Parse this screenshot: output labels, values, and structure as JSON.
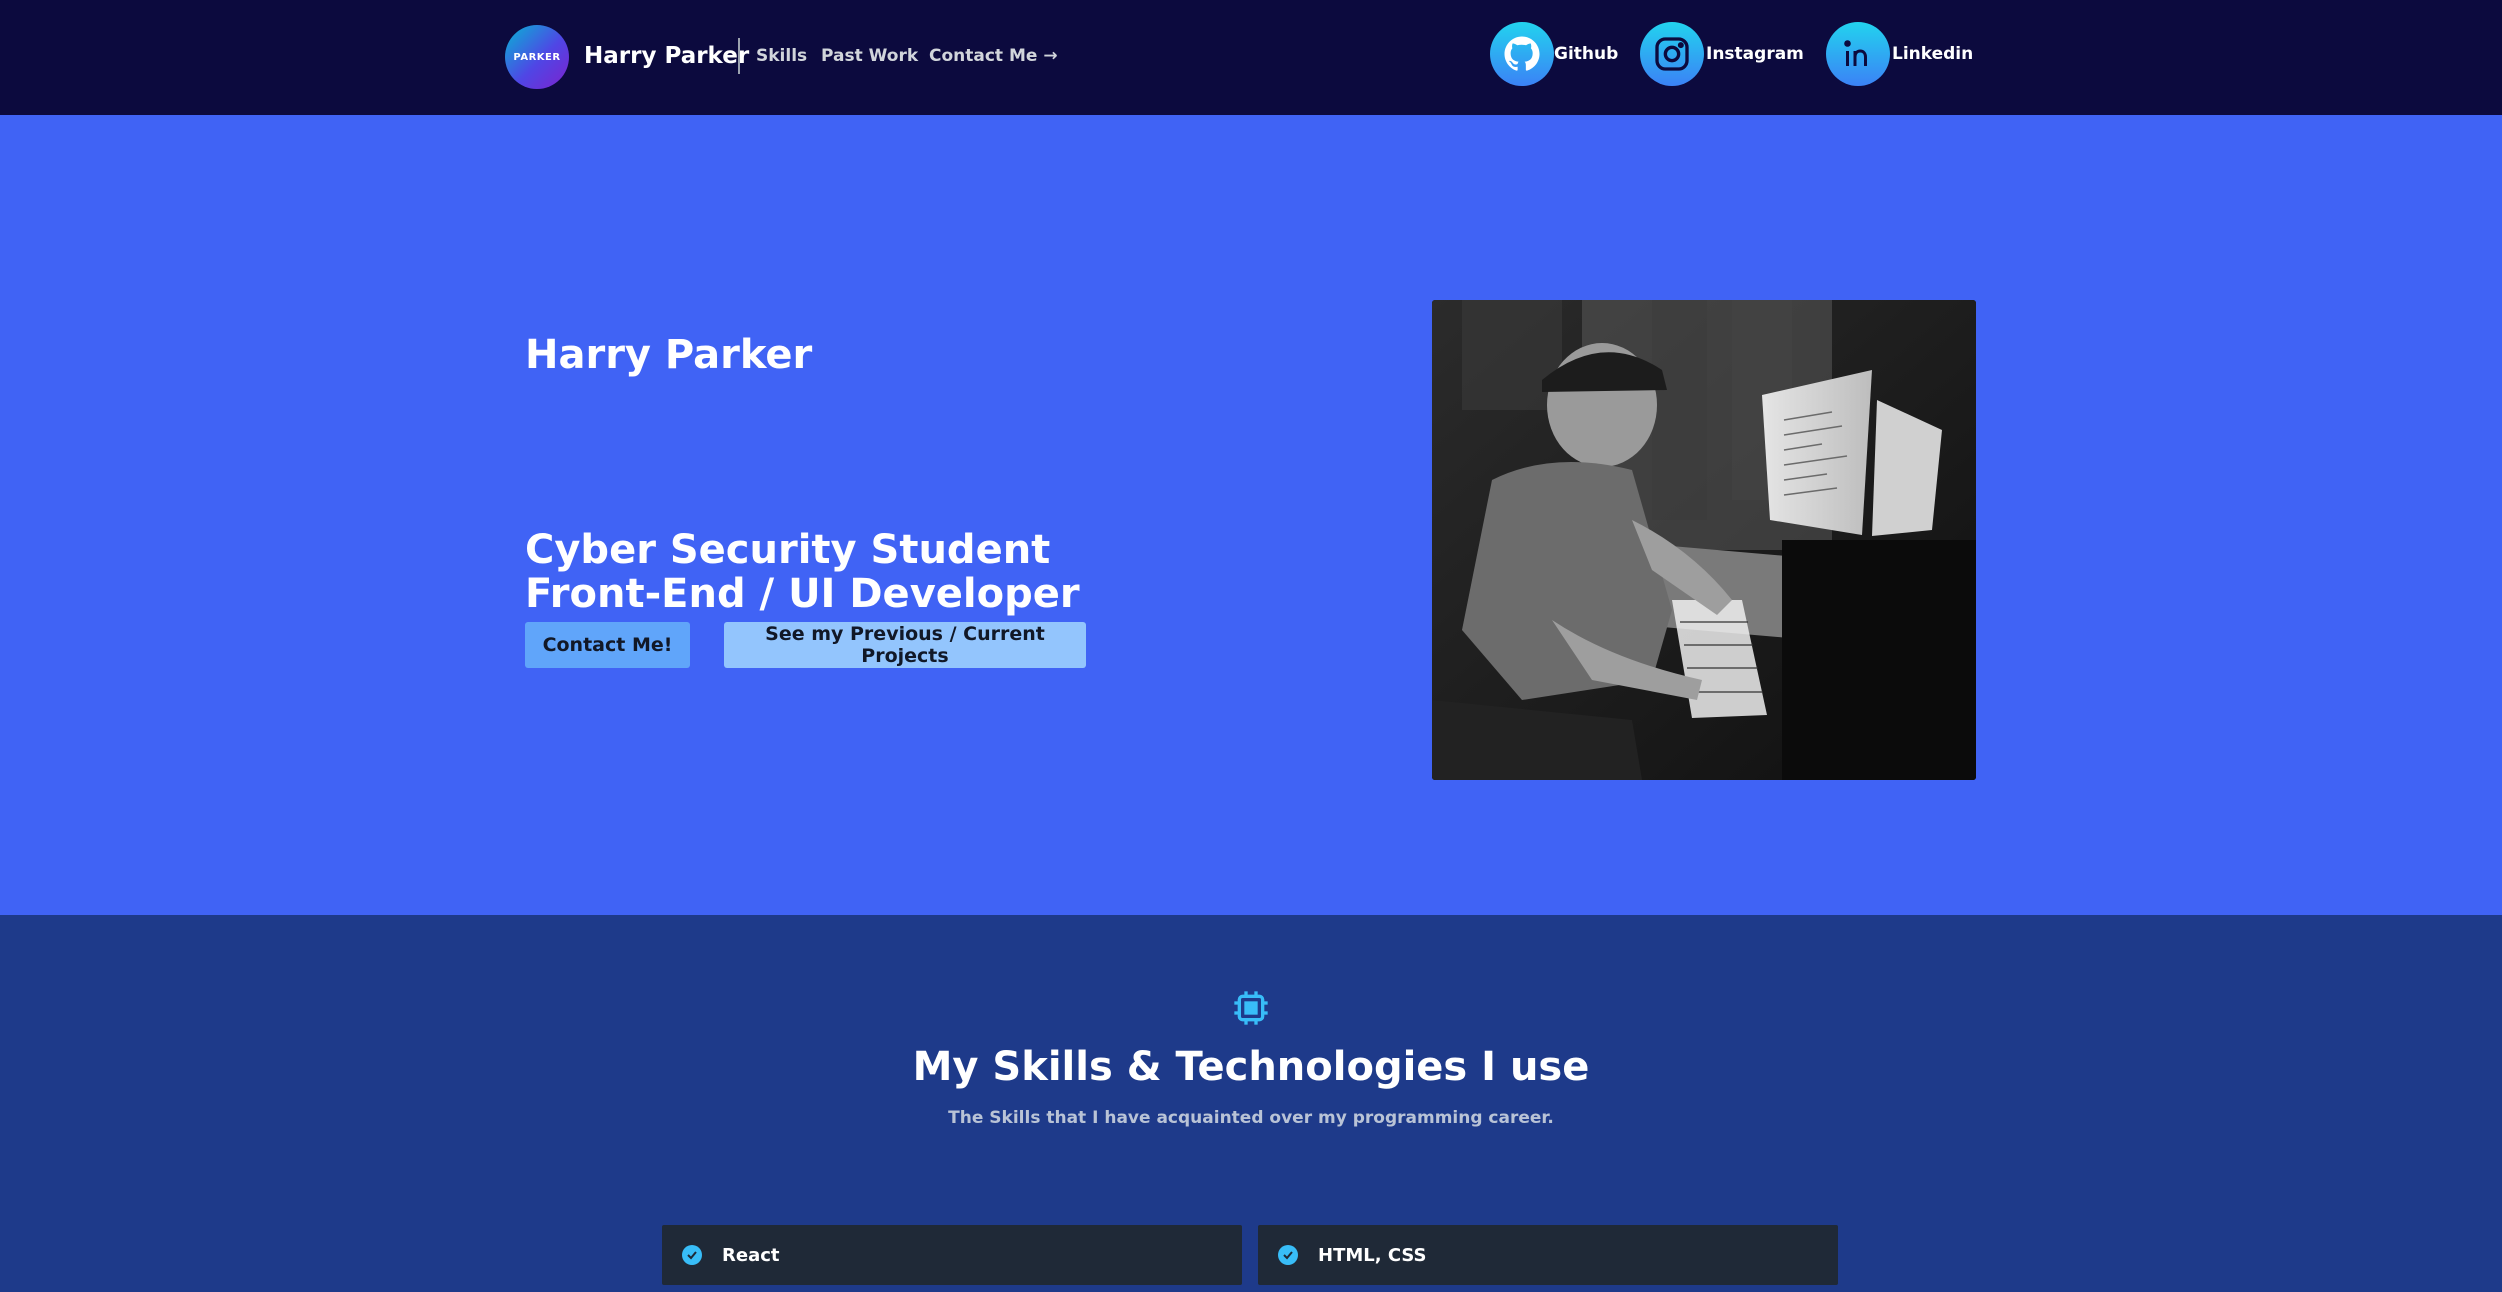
{
  "nav": {
    "logo_text": "PARKER",
    "brand": "Harry Parker",
    "links": [
      {
        "label": "Skills"
      },
      {
        "label": "Past Work"
      },
      {
        "label": "Contact Me →"
      }
    ],
    "socials": [
      {
        "label": "Github",
        "icon": "github-icon"
      },
      {
        "label": "Instagram",
        "icon": "instagram-icon"
      },
      {
        "label": "Linkedin",
        "icon": "linkedin-icon"
      }
    ]
  },
  "hero": {
    "name": "Harry Parker",
    "role_line1": "Cyber Security Student",
    "role_line2": "Front-End / UI Developer",
    "contact_button": "Contact Me!",
    "projects_button": "See my Previous / Current Projects",
    "photo_icon": "developer-photo"
  },
  "skills": {
    "icon": "chip-icon",
    "title": "My Skills & Technologies I use",
    "subtitle": "The Skills that I have acquainted over my programming career.",
    "items": [
      {
        "label": "React"
      },
      {
        "label": "HTML, CSS"
      }
    ]
  },
  "colors": {
    "nav_bg": "#0c0a3e",
    "hero_bg": "#4063f5",
    "skills_bg": "#1e3a8a",
    "card_bg": "#1f2937",
    "accent": "#38bdf8"
  }
}
